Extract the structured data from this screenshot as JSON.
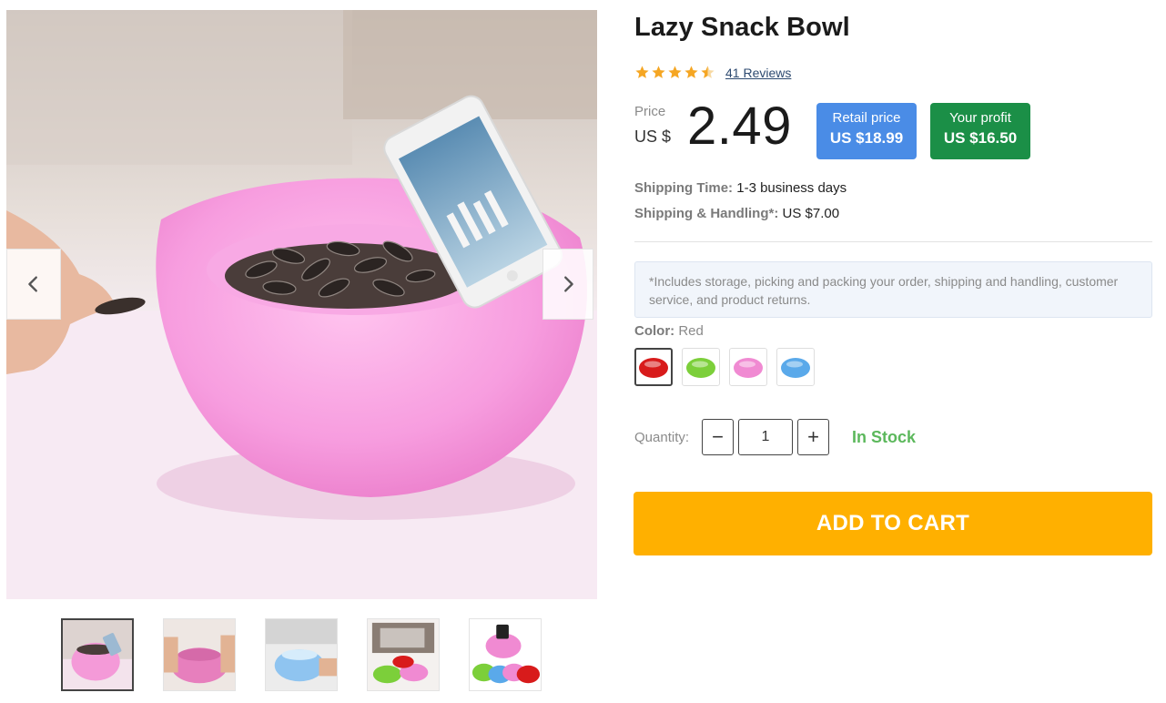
{
  "product": {
    "title": "Lazy Snack Bowl",
    "rating": 4.5,
    "reviews_label": "41 Reviews",
    "price_label": "Price",
    "currency": "US $",
    "price": "2.49",
    "retail": {
      "label": "Retail price",
      "value": "US $18.99"
    },
    "profit": {
      "label": "Your profit",
      "value": "US $16.50"
    },
    "shipping_time": {
      "label": "Shipping Time:",
      "value": "1-3 business days"
    },
    "shipping_handling": {
      "label": "Shipping & Handling*:",
      "value": "US $7.00"
    },
    "note": "*Includes storage, picking and packing your order, shipping and handling, customer service, and product returns."
  },
  "color": {
    "label": "Color:",
    "selected": "Red",
    "options": [
      {
        "name": "Red",
        "hex": "#d81b1b"
      },
      {
        "name": "Green",
        "hex": "#7ccf3a"
      },
      {
        "name": "Pink",
        "hex": "#f08ad2"
      },
      {
        "name": "Blue",
        "hex": "#5aa9ea"
      }
    ]
  },
  "quantity": {
    "label": "Quantity:",
    "value": "1",
    "minus": "−",
    "plus": "+",
    "stock": "In Stock"
  },
  "cart": {
    "label": "ADD TO CART"
  },
  "colors": {
    "accent_blue": "#4a8ce6",
    "accent_green": "#1b8f47",
    "stock_green": "#5cb85c",
    "cart_orange": "#ffb000"
  },
  "gallery": {
    "thumbnails": [
      "pink-bowl-with-phone",
      "hands-holding-pink-bowl",
      "blue-bowl",
      "bowls-on-table",
      "four-color-bowls"
    ],
    "active_index": 0
  }
}
